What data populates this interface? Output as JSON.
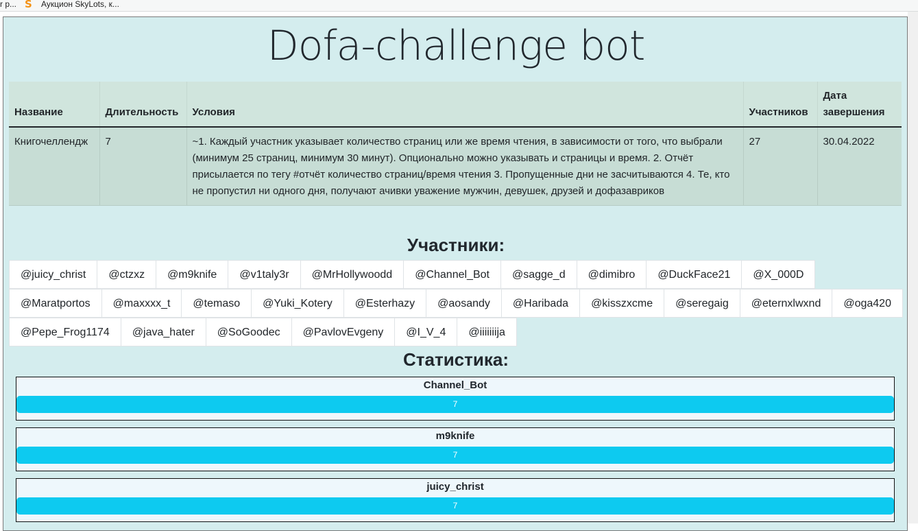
{
  "browser": {
    "bookmarks": [
      {
        "label": "r p..."
      },
      {
        "label": "Аукцион SkyLots, к...",
        "icon": "skylots-s-icon"
      }
    ]
  },
  "page": {
    "title": "Dofa-challenge bot"
  },
  "challenge_table": {
    "headers": {
      "name": "Название",
      "duration": "Длительность",
      "conditions": "Условия",
      "participants": "Участников",
      "end_date": "Дата завершения"
    },
    "row": {
      "name": "Книгочеллендж",
      "duration": "7",
      "conditions": "~1. Каждый участник указывает количество страниц или же время чтения, в зависимости от того, что выбрали (минимум 25 страниц, минимум 30 минут). Опционально можно указывать и страницы и время. 2. Отчёт присылается по тегу #отчёт количество страниц/время чтения 3. Пропущенные дни не засчитываются 4. Те, кто не пропустил ни одного дня, получают ачивки уважение мужчин, девушек, друзей и дофазавриков",
      "participants": "27",
      "end_date": "30.04.2022"
    }
  },
  "participants_section": {
    "heading": "Участники:",
    "items": [
      "@juicy_christ",
      "@ctzxz",
      "@m9knife",
      "@v1taly3r",
      "@MrHollywoodd",
      "@Channel_Bot",
      "@sagge_d",
      "@dimibro",
      "@DuckFace21",
      "@X_000D",
      "@Maratportos",
      "@maxxxx_t",
      "@temaso",
      "@Yuki_Kotery",
      "@Esterhazy",
      "@aosandy",
      "@Haribada",
      "@kisszxcme",
      "@seregaig",
      "@eternxlwxnd",
      "@oga420",
      "@Pepe_Frog1174",
      "@java_hater",
      "@SoGoodec",
      "@PavlovEvgeny",
      "@I_V_4",
      "@iiiiiiija"
    ]
  },
  "stats_section": {
    "heading": "Статистика:",
    "bar_color": "#0dcaf0",
    "entries": [
      {
        "name": "Channel_Bot",
        "value": "7",
        "progress": 1.0
      },
      {
        "name": "m9knife",
        "value": "7",
        "progress": 1.0
      },
      {
        "name": "juicy_christ",
        "value": "7",
        "progress": 1.0
      }
    ]
  }
}
